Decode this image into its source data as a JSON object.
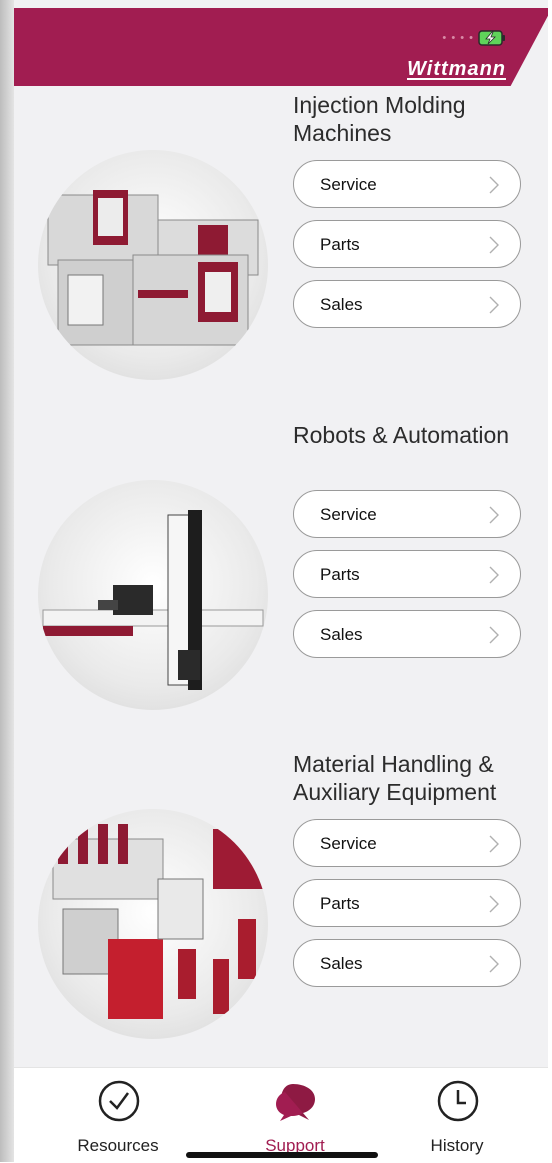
{
  "header": {
    "logo_text": "Wittmann",
    "brand_color": "#a11d51"
  },
  "sections": [
    {
      "title": "Injection Molding Machines",
      "image_icon": "injection-molding-machines-image",
      "buttons": [
        "Service",
        "Parts",
        "Sales"
      ]
    },
    {
      "title": "Robots & Automation",
      "image_icon": "robot-automation-image",
      "buttons": [
        "Service",
        "Parts",
        "Sales"
      ]
    },
    {
      "title": "Material Handling & Auxiliary Equipment",
      "image_icon": "material-handling-equipment-image",
      "buttons": [
        "Service",
        "Parts",
        "Sales"
      ]
    }
  ],
  "tabbar": {
    "items": [
      {
        "label": "Resources",
        "icon": "check-circle-icon"
      },
      {
        "label": "Support",
        "icon": "chat-bubbles-icon",
        "active": true
      },
      {
        "label": "History",
        "icon": "clock-icon"
      }
    ]
  }
}
